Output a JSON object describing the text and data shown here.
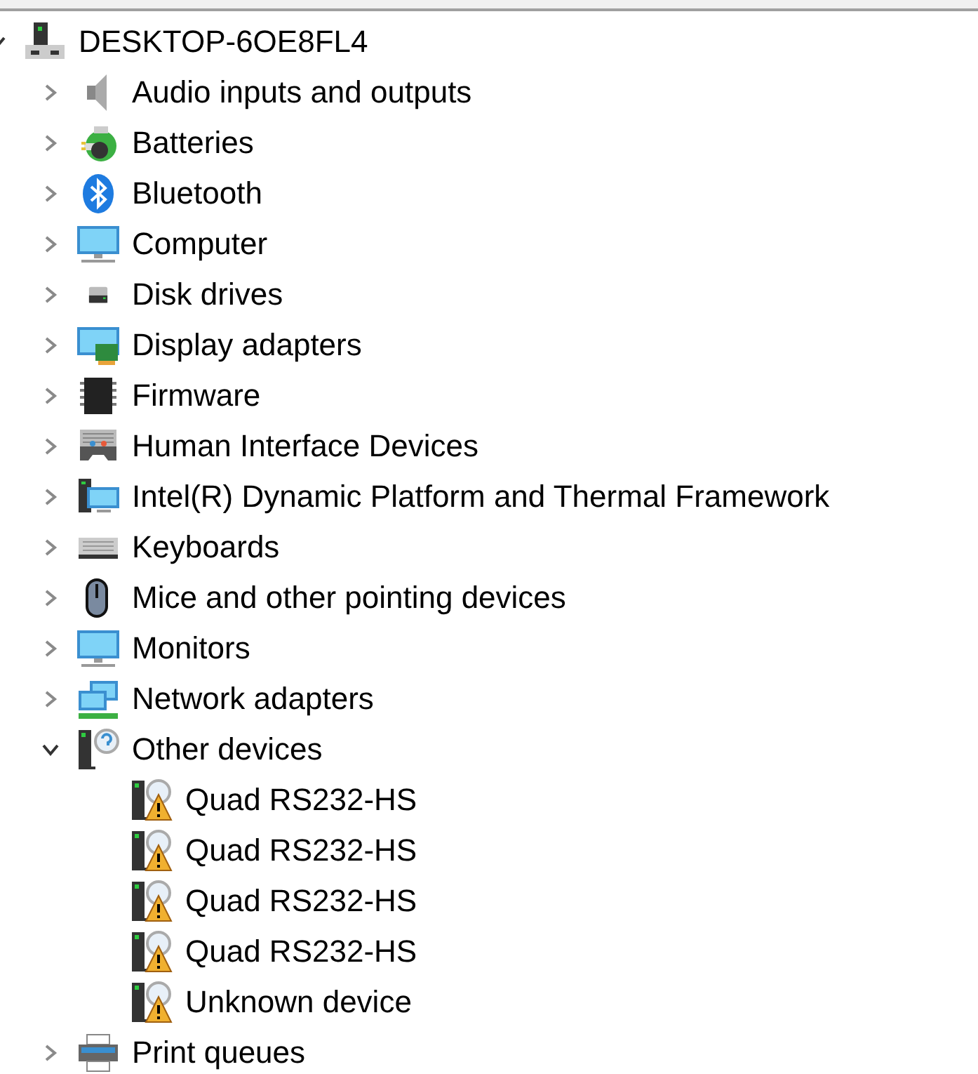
{
  "tree": {
    "label": "DESKTOP-6OE8FL4",
    "expanded": true,
    "children": [
      {
        "label": "Audio inputs and outputs",
        "expanded": false
      },
      {
        "label": "Batteries",
        "expanded": false
      },
      {
        "label": "Bluetooth",
        "expanded": false
      },
      {
        "label": "Computer",
        "expanded": false
      },
      {
        "label": "Disk drives",
        "expanded": false
      },
      {
        "label": "Display adapters",
        "expanded": false
      },
      {
        "label": "Firmware",
        "expanded": false
      },
      {
        "label": "Human Interface Devices",
        "expanded": false
      },
      {
        "label": "Intel(R) Dynamic Platform and Thermal Framework",
        "expanded": false
      },
      {
        "label": "Keyboards",
        "expanded": false
      },
      {
        "label": "Mice and other pointing devices",
        "expanded": false
      },
      {
        "label": "Monitors",
        "expanded": false
      },
      {
        "label": "Network adapters",
        "expanded": false
      },
      {
        "label": "Other devices",
        "expanded": true,
        "children": [
          {
            "label": "Quad RS232-HS",
            "warning": true
          },
          {
            "label": "Quad RS232-HS",
            "warning": true
          },
          {
            "label": "Quad RS232-HS",
            "warning": true
          },
          {
            "label": "Quad RS232-HS",
            "warning": true
          },
          {
            "label": "Unknown device",
            "warning": true
          }
        ]
      },
      {
        "label": "Print queues",
        "expanded": false
      }
    ]
  }
}
